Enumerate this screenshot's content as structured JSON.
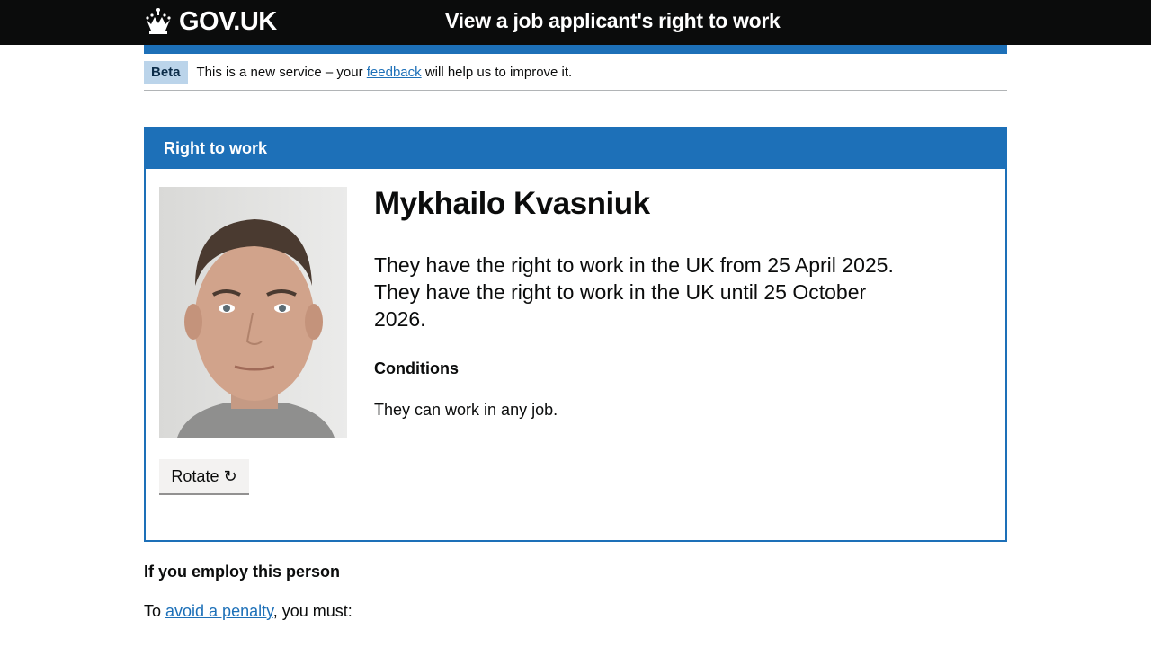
{
  "header": {
    "logo_text": "GOV.UK",
    "service_name": "View a job applicant's right to work"
  },
  "phase_banner": {
    "tag": "Beta",
    "text_before": "This is a new service – your ",
    "link": "feedback",
    "text_after": " will help us to improve it."
  },
  "panel": {
    "title": "Right to work",
    "person_name": "Mykhailo Kvasniuk",
    "rtw_from": "They have the right to work in the UK from 25 April 2025.",
    "rtw_until": "They have the right to work in the UK until 25 October 2026.",
    "conditions_heading": "Conditions",
    "conditions_text": "They can work in any job.",
    "rotate_label": "Rotate",
    "rotate_icon": "↻"
  },
  "employ": {
    "heading": "If you employ this person",
    "text_before": "To ",
    "link": "avoid a penalty",
    "text_after": ", you must:"
  },
  "colors": {
    "header_bg": "#0b0c0c",
    "brand_blue": "#1d70b8",
    "beta_tag_bg": "#bbd4ea",
    "button_bg": "#f3f2f1"
  },
  "icons": {
    "logo": "crown-icon",
    "rotate": "rotate-clockwise-icon"
  }
}
